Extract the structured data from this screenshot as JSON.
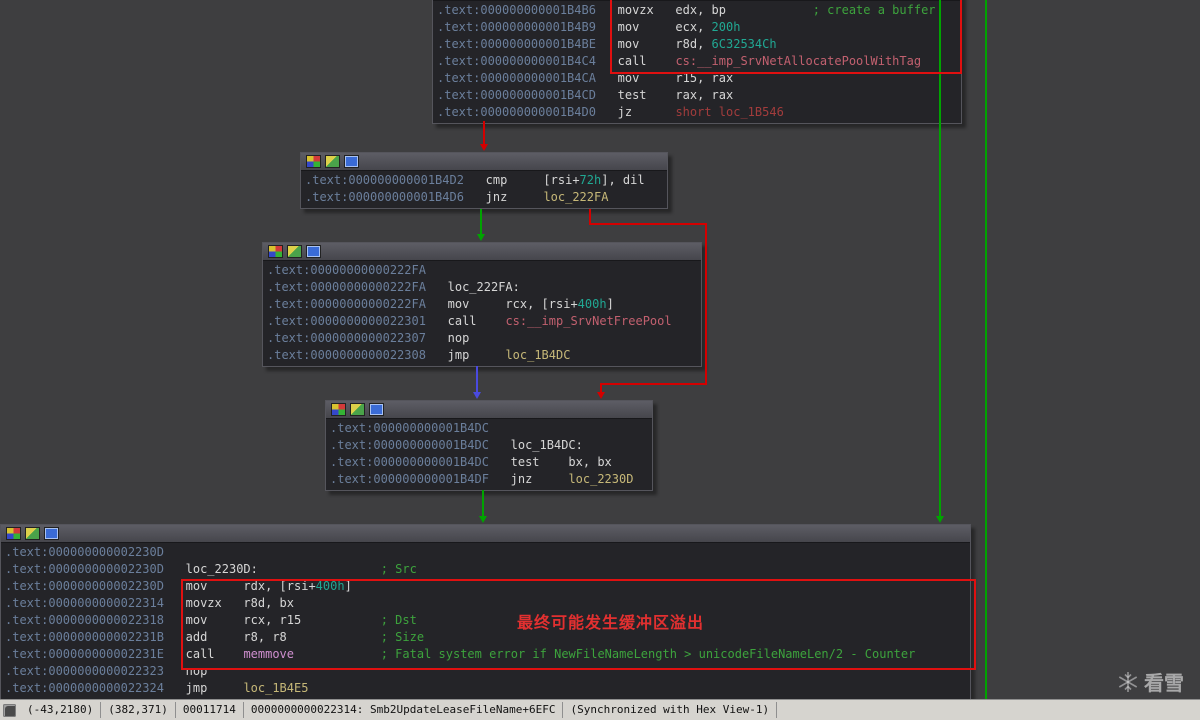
{
  "theme": {
    "background": "#3e3e40",
    "node_background": "#242428",
    "node_title": "#4c4c54",
    "address_color": "#6b7f9c",
    "text_color": "#d6d6d6",
    "number_color": "#21a893",
    "comment_color": "#3da33d",
    "import_color": "#c2606f",
    "loc_color": "#c6b878",
    "loc_far_color": "#a23c3c",
    "libfunc_color": "#cf8fcf",
    "edge_taken": "#00a400",
    "edge_not_taken": "#d40000",
    "edge_unconditional": "#4a4adf",
    "highlight_box": "#e01010"
  },
  "blocks": [
    {
      "name": "node-1B4B6",
      "lines": [
        [
          [
            "a",
            ".text:000000000001B4B6"
          ],
          [
            "t",
            "   movzx   edx, bp            "
          ],
          [
            "c",
            "; create a buffer"
          ]
        ],
        [
          [
            "a",
            ".text:000000000001B4B9"
          ],
          [
            "t",
            "   mov     ecx, "
          ],
          [
            "n",
            "200h"
          ]
        ],
        [
          [
            "a",
            ".text:000000000001B4BE"
          ],
          [
            "t",
            "   mov     r8d, "
          ],
          [
            "n",
            "6C32534Ch"
          ]
        ],
        [
          [
            "a",
            ".text:000000000001B4C4"
          ],
          [
            "t",
            "   call    "
          ],
          [
            "i",
            "cs:__imp_SrvNetAllocatePoolWithTag"
          ]
        ],
        [
          [
            "a",
            ".text:000000000001B4CA"
          ],
          [
            "t",
            "   mov     r15, rax"
          ]
        ],
        [
          [
            "a",
            ".text:000000000001B4CD"
          ],
          [
            "t",
            "   test    rax, rax"
          ]
        ],
        [
          [
            "a",
            ".text:000000000001B4D0"
          ],
          [
            "t",
            "   jz      "
          ],
          [
            "r",
            "short loc_1B546"
          ]
        ]
      ]
    },
    {
      "name": "node-1B4D2",
      "lines": [
        [
          [
            "a",
            ".text:000000000001B4D2"
          ],
          [
            "t",
            "   cmp     [rsi+"
          ],
          [
            "n",
            "72h"
          ],
          [
            "t",
            "], dil"
          ]
        ],
        [
          [
            "a",
            ".text:000000000001B4D6"
          ],
          [
            "t",
            "   jnz     "
          ],
          [
            "l",
            "loc_222FA"
          ]
        ]
      ]
    },
    {
      "name": "node-222FA",
      "lines": [
        [
          [
            "a",
            ".text:00000000000222FA"
          ]
        ],
        [
          [
            "a",
            ".text:00000000000222FA"
          ],
          [
            "t",
            "   loc_222FA:"
          ]
        ],
        [
          [
            "a",
            ".text:00000000000222FA"
          ],
          [
            "t",
            "   mov     rcx, [rsi+"
          ],
          [
            "n",
            "400h"
          ],
          [
            "t",
            "]"
          ]
        ],
        [
          [
            "a",
            ".text:0000000000022301"
          ],
          [
            "t",
            "   call    "
          ],
          [
            "i",
            "cs:__imp_SrvNetFreePool"
          ]
        ],
        [
          [
            "a",
            ".text:0000000000022307"
          ],
          [
            "t",
            "   nop"
          ]
        ],
        [
          [
            "a",
            ".text:0000000000022308"
          ],
          [
            "t",
            "   jmp     "
          ],
          [
            "l",
            "loc_1B4DC"
          ]
        ]
      ]
    },
    {
      "name": "node-1B4DC",
      "lines": [
        [
          [
            "a",
            ".text:000000000001B4DC"
          ]
        ],
        [
          [
            "a",
            ".text:000000000001B4DC"
          ],
          [
            "t",
            "   loc_1B4DC:"
          ]
        ],
        [
          [
            "a",
            ".text:000000000001B4DC"
          ],
          [
            "t",
            "   test    bx, bx"
          ]
        ],
        [
          [
            "a",
            ".text:000000000001B4DF"
          ],
          [
            "t",
            "   jnz     "
          ],
          [
            "l",
            "loc_2230D"
          ]
        ]
      ]
    },
    {
      "name": "node-2230D",
      "lines": [
        [
          [
            "a",
            ".text:000000000002230D"
          ]
        ],
        [
          [
            "a",
            ".text:000000000002230D"
          ],
          [
            "t",
            "   loc_2230D:                 "
          ],
          [
            "c",
            "; Src"
          ]
        ],
        [
          [
            "a",
            ".text:000000000002230D"
          ],
          [
            "t",
            "   mov     rdx, [rsi+"
          ],
          [
            "n",
            "400h"
          ],
          [
            "t",
            "]"
          ]
        ],
        [
          [
            "a",
            ".text:0000000000022314"
          ],
          [
            "t",
            "   movzx   r8d, bx"
          ]
        ],
        [
          [
            "a",
            ".text:0000000000022318"
          ],
          [
            "t",
            "   mov     rcx, r15           "
          ],
          [
            "c",
            "; Dst"
          ]
        ],
        [
          [
            "a",
            ".text:000000000002231B"
          ],
          [
            "t",
            "   add     r8, r8             "
          ],
          [
            "c",
            "; Size"
          ]
        ],
        [
          [
            "a",
            ".text:000000000002231E"
          ],
          [
            "t",
            "   call    "
          ],
          [
            "m",
            "memmove"
          ],
          [
            "t",
            "            "
          ],
          [
            "c",
            "; Fatal system error if NewFileNameLength > unicodeFileNameLen/2 - Counter"
          ]
        ],
        [
          [
            "a",
            ".text:0000000000022323"
          ],
          [
            "t",
            "   nop"
          ]
        ],
        [
          [
            "a",
            ".text:0000000000022324"
          ],
          [
            "t",
            "   jmp     "
          ],
          [
            "l",
            "loc_1B4E5"
          ]
        ]
      ]
    }
  ],
  "annotations": {
    "overflow_note": {
      "text": "最终可能发生缓冲区溢出",
      "color": "#e23030"
    }
  },
  "statusbar": {
    "segments": [
      "(-43,2180)",
      "(382,371)",
      "00011714",
      "0000000000022314: Smb2UpdateLeaseFileName+6EFC",
      "(Synchronized with Hex View-1)"
    ]
  },
  "watermark": {
    "text": "看雪"
  }
}
